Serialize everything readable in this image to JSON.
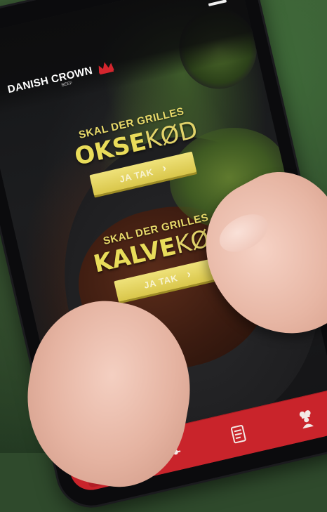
{
  "app": {
    "brand": "DANISH CROWN",
    "brand_sub": "BEEF"
  },
  "promos": [
    {
      "kicker": "SKAL DER GRILLES",
      "headline_bold": "OKSE",
      "headline_light": "KØD",
      "cta": "JA TAK",
      "cta_icon": "chevron-right-icon"
    },
    {
      "kicker": "SKAL DER GRILLES",
      "headline_bold": "KALVE",
      "headline_light": "KØD",
      "cta": "JA TAK",
      "cta_icon": "chevron-right-icon"
    }
  ],
  "tabbar": {
    "tabs": [
      {
        "icon": "meat-icon",
        "active": true
      },
      {
        "icon": "filter-sliders-icon",
        "active": false
      },
      {
        "icon": "recipe-note-icon",
        "active": false
      },
      {
        "icon": "chef-icon",
        "active": false
      }
    ]
  },
  "colors": {
    "accent_yellow": "#e9dc5a",
    "tabbar_red": "#c9242b",
    "logo_crown_red": "#d4262e"
  }
}
